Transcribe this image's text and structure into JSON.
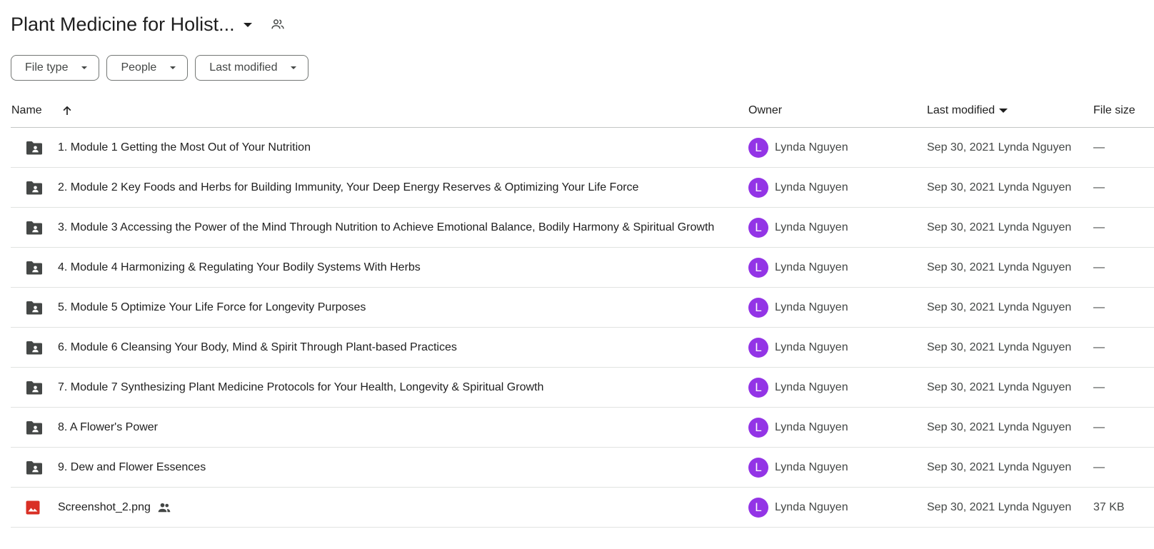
{
  "folder": {
    "title": "Plant Medicine for Holist...",
    "shared_icon": "people-outline-icon"
  },
  "filters": [
    {
      "label": "File type"
    },
    {
      "label": "People"
    },
    {
      "label": "Last modified"
    }
  ],
  "columns": {
    "name": "Name",
    "owner": "Owner",
    "last_modified": "Last modified",
    "file_size": "File size",
    "sort_icon": "arrow-up-icon"
  },
  "colors": {
    "avatar": "#9334e6",
    "folder_icon": "#444746",
    "image_icon": "#d93025"
  },
  "rows": [
    {
      "type": "shared-folder",
      "name": "1. Module 1 Getting the Most Out of Your Nutrition",
      "owner_initial": "L",
      "owner": "Lynda Nguyen",
      "modified": "Sep 30, 2021 Lynda Nguyen",
      "size": "—",
      "shared": false
    },
    {
      "type": "shared-folder",
      "name": "2. Module 2 Key Foods and Herbs for Building Immunity, Your Deep Energy Reserves & Optimizing Your Life Force",
      "owner_initial": "L",
      "owner": "Lynda Nguyen",
      "modified": "Sep 30, 2021 Lynda Nguyen",
      "size": "—",
      "shared": false
    },
    {
      "type": "shared-folder",
      "name": "3. Module 3 Accessing the Power of the Mind Through Nutrition to Achieve Emotional Balance, Bodily Harmony & Spiritual Growth",
      "owner_initial": "L",
      "owner": "Lynda Nguyen",
      "modified": "Sep 30, 2021 Lynda Nguyen",
      "size": "—",
      "shared": false
    },
    {
      "type": "shared-folder",
      "name": "4. Module 4 Harmonizing & Regulating Your Bodily Systems With Herbs",
      "owner_initial": "L",
      "owner": "Lynda Nguyen",
      "modified": "Sep 30, 2021 Lynda Nguyen",
      "size": "—",
      "shared": false
    },
    {
      "type": "shared-folder",
      "name": "5. Module 5 Optimize Your Life Force for Longevity Purposes",
      "owner_initial": "L",
      "owner": "Lynda Nguyen",
      "modified": "Sep 30, 2021 Lynda Nguyen",
      "size": "—",
      "shared": false
    },
    {
      "type": "shared-folder",
      "name": "6. Module 6 Cleansing Your Body, Mind & Spirit Through Plant-based Practices",
      "owner_initial": "L",
      "owner": "Lynda Nguyen",
      "modified": "Sep 30, 2021 Lynda Nguyen",
      "size": "—",
      "shared": false
    },
    {
      "type": "shared-folder",
      "name": "7. Module 7 Synthesizing Plant Medicine Protocols for Your Health, Longevity & Spiritual Growth",
      "owner_initial": "L",
      "owner": "Lynda Nguyen",
      "modified": "Sep 30, 2021 Lynda Nguyen",
      "size": "—",
      "shared": false
    },
    {
      "type": "shared-folder",
      "name": "8. A Flower's Power",
      "owner_initial": "L",
      "owner": "Lynda Nguyen",
      "modified": "Sep 30, 2021 Lynda Nguyen",
      "size": "—",
      "shared": false
    },
    {
      "type": "shared-folder",
      "name": "9. Dew and Flower Essences",
      "owner_initial": "L",
      "owner": "Lynda Nguyen",
      "modified": "Sep 30, 2021 Lynda Nguyen",
      "size": "—",
      "shared": false
    },
    {
      "type": "image",
      "name": "Screenshot_2.png",
      "owner_initial": "L",
      "owner": "Lynda Nguyen",
      "modified": "Sep 30, 2021 Lynda Nguyen",
      "size": "37 KB",
      "shared": true
    }
  ]
}
